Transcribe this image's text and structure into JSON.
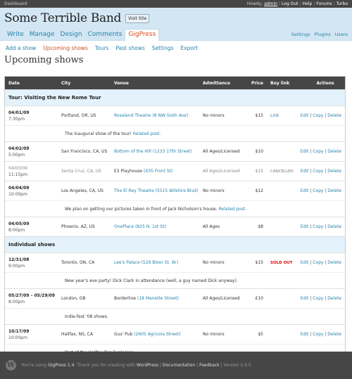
{
  "adminbar": {
    "dashboard": "Dashboard",
    "howdy": "Howdy,",
    "user": "admin",
    "links": [
      "Log Out",
      "Help",
      "Forums",
      "Turbo"
    ]
  },
  "header": {
    "title": "Some Terrible Band",
    "visit_site": "Visit Site"
  },
  "mainnav": {
    "tabs": [
      "Write",
      "Manage",
      "Design",
      "Comments",
      "GigPress"
    ],
    "right": [
      "Settings",
      "Plugins",
      "Users"
    ]
  },
  "subnav": [
    "Add a show",
    "Upcoming shows",
    "Tours",
    "Past shows",
    "Settings",
    "Export"
  ],
  "page_title": "Upcoming shows",
  "table": {
    "columns": [
      "Date",
      "City",
      "Venue",
      "Admittance",
      "Price",
      "Buy link",
      "Actions"
    ],
    "actions": {
      "edit": "Edit",
      "copy": "Copy",
      "delete": "Delete",
      "sep": " | "
    },
    "groups": [
      {
        "title": "Tour: Visiting the New Rome Tour",
        "shows": [
          {
            "date": "04/01/09",
            "time": "7:30pm",
            "city": "Portland, OR, US",
            "venue_name": "Roseland Theatre",
            "venue_addr": "(8 NW Sixth Ave)",
            "admittance": "No minors",
            "price": "$15",
            "buy": "Link",
            "note_text": "The inaugural show of the tour!",
            "note_link": "Related post."
          },
          {
            "date": "04/02/09",
            "time": "5:00pm",
            "city": "San Francisco, CA, US",
            "venue_name": "Bottom of the Hill",
            "venue_addr": "(1233 17th Street)",
            "admittance": "All Ages/Licensed",
            "price": "$10",
            "buy": ""
          },
          {
            "date": "04/03/09",
            "time": "11:15pm",
            "city": "Santa Cruz, CA, US",
            "venue_name": "E3 Playhouse",
            "venue_addr": "(435 Front St)",
            "admittance": "All Ages/Licensed",
            "price": "$15",
            "buy": "CANCELLED",
            "status": "cancelled"
          },
          {
            "date": "04/04/09",
            "time": "10:00pm",
            "city": "Los Angeles, CA, US",
            "venue_name": "The El Rey Theatre",
            "venue_addr": "(5515 Wilshire Blvd)",
            "admittance": "No minors",
            "price": "$12",
            "buy": "",
            "note_text": "We plan on getting our pictures taken in front of Jack Nicholson's house.",
            "note_link": "Related post."
          },
          {
            "date": "04/05/09",
            "time": "8:00pm",
            "city": "Phoenix, AZ, US",
            "venue_name": "OnePlace",
            "venue_addr": "(825 N. 1st St)",
            "admittance": "All Ages",
            "price": "$8",
            "buy": ""
          }
        ]
      },
      {
        "title": "Individual shows",
        "shows": [
          {
            "date": "12/31/08",
            "time": "9:00pm",
            "city": "Toronto, ON, CA",
            "venue_name": "Lee's Palace",
            "venue_addr": "(529 Bloor St. W.)",
            "admittance": "No minors",
            "price": "$15",
            "buy": "SOLD OUT",
            "status": "soldout",
            "note_text": "New year's eve party! Dick Clark in attendance (well, a guy named Dick anyway).",
            "note_link": ""
          },
          {
            "date": "05/27/09 – 05/29/09",
            "time": "8:00pm",
            "city": "London, GB",
            "venue_name": "Borderline",
            "venue_addr": "(18 Manette Street)",
            "venue_plain": true,
            "admittance": "All Ages/Licensed",
            "price": "£10",
            "buy": "",
            "note_text": "Indie-fest '08 shows.",
            "note_link": ""
          },
          {
            "date": "10/17/09",
            "time": "10:00pm",
            "city": "Halifax, NS, CA",
            "venue_name": "Gus' Pub",
            "venue_addr": "(2605 Agricola Street)",
            "venue_plain": true,
            "admittance": "No minors",
            "price": "$5",
            "buy": "",
            "note_text": "Part of the Halifax Pop Explosion.",
            "note_link": ""
          }
        ]
      }
    ]
  },
  "footer": {
    "logo": "W",
    "prefix": "You're using",
    "plugin": "GigPress 1.4",
    "thanks": ". Thank you for creating with",
    "wordpress": "WordPress",
    "documentation": "Documentation",
    "feedback": "Feedback",
    "version": "Version 2.6.5"
  }
}
